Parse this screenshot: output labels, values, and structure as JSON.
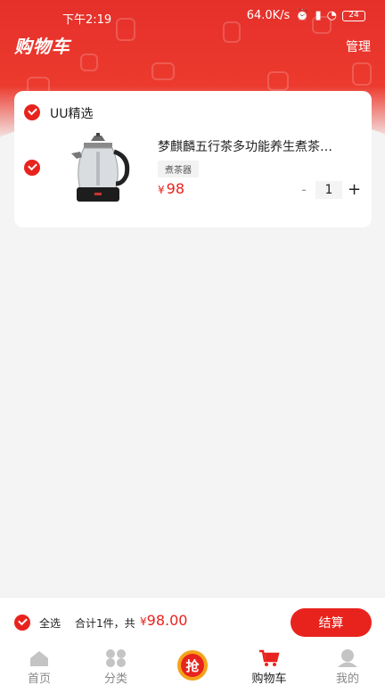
{
  "status_bar": {
    "time": "下午2:19",
    "network_speed": "64.0K/s",
    "battery": "24"
  },
  "header": {
    "title": "购物车",
    "manage_label": "管理"
  },
  "cart": {
    "shop_name": "UU精选",
    "items": [
      {
        "title": "梦麒麟五行茶多功能养生煮茶…",
        "spec": "煮茶器",
        "price_symbol": "¥",
        "price": "98",
        "quantity": "1",
        "minus_label": "-",
        "plus_label": "+"
      }
    ]
  },
  "checkout": {
    "select_all_label": "全选",
    "summary_text": "合计1件，共",
    "total_symbol": "¥",
    "total": "98.00",
    "button_label": "结算"
  },
  "tabbar": {
    "items": [
      {
        "label": "首页",
        "icon": "home-icon"
      },
      {
        "label": "分类",
        "icon": "category-icon"
      },
      {
        "label": "",
        "icon": "grab-deal-icon",
        "center_text": "抢"
      },
      {
        "label": "购物车",
        "icon": "cart-icon"
      },
      {
        "label": "我的",
        "icon": "profile-icon"
      }
    ]
  },
  "colors": {
    "brand_red": "#e8231d",
    "header_red": "#e5302a"
  }
}
